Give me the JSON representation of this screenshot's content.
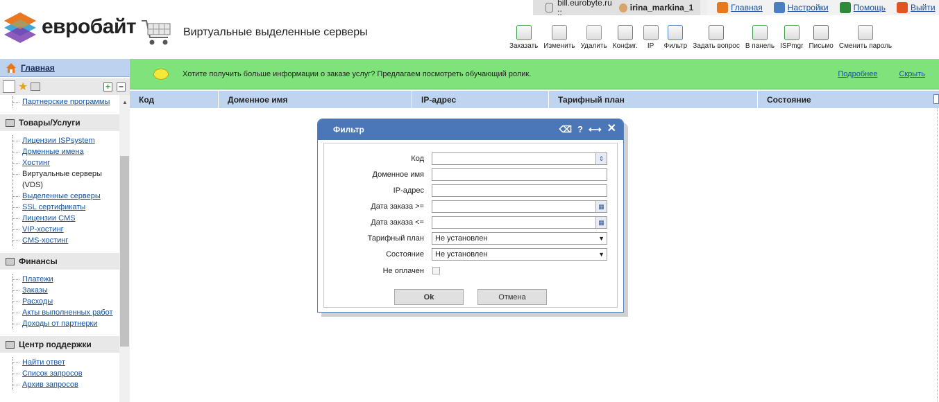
{
  "brand": {
    "name": "евробайт"
  },
  "page": {
    "title": "Виртуальные выделенные серверы"
  },
  "topbar": {
    "host": "bill.eurobyte.ru ::",
    "user": "irina_markina_1",
    "links": [
      {
        "label": "Главная",
        "icon": "home-icon",
        "color": "#e9781c"
      },
      {
        "label": "Настройки",
        "icon": "settings-icon",
        "color": "#4a7fc0"
      },
      {
        "label": "Помощь",
        "icon": "help-icon",
        "color": "#2f8a3a"
      },
      {
        "label": "Выйти",
        "icon": "power-icon",
        "color": "#e05520"
      }
    ]
  },
  "toolbar": [
    {
      "label": "Заказать",
      "icon": "order-icon",
      "color": "#3aa04a"
    },
    {
      "label": "Изменить",
      "icon": "edit-icon",
      "color": "#888"
    },
    {
      "label": "Удалить",
      "icon": "delete-icon",
      "color": "#999"
    },
    {
      "label": "Конфиг.",
      "icon": "config-icon",
      "color": "#777"
    },
    {
      "label": "IP",
      "icon": "ip-icon",
      "color": "#888"
    },
    {
      "label": "Фильтр",
      "icon": "filter-icon",
      "color": "#4a7fc0"
    },
    {
      "label": "Задать вопрос",
      "icon": "ask-question-icon",
      "color": "#777"
    },
    {
      "label": "В панель",
      "icon": "to-panel-icon",
      "color": "#3aa04a"
    },
    {
      "label": "ISPmgr",
      "icon": "ispmgr-icon",
      "color": "#3aa04a"
    },
    {
      "label": "Письмо",
      "icon": "letter-icon",
      "color": "#666"
    },
    {
      "label": "Сменить пароль",
      "icon": "change-password-icon",
      "color": "#888"
    }
  ],
  "sidebar": {
    "home": "Главная",
    "top_item": "Партнерские программы",
    "sections": [
      {
        "title": "Товары/Услуги",
        "icon": "cart-icon",
        "items": [
          {
            "label": "Лицензии ISPsystem",
            "link": true
          },
          {
            "label": "Доменные имена",
            "link": true
          },
          {
            "label": "Хостинг",
            "link": true
          },
          {
            "label": "Виртуальные серверы (VDS)",
            "link": false
          },
          {
            "label": "Выделенные серверы",
            "link": true
          },
          {
            "label": "SSL сертификаты",
            "link": true
          },
          {
            "label": "Лицензии CMS",
            "link": true
          },
          {
            "label": "VIP-хостинг",
            "link": true
          },
          {
            "label": "CMS-хостинг",
            "link": true
          }
        ]
      },
      {
        "title": "Финансы",
        "icon": "finance-icon",
        "items": [
          {
            "label": "Платежи",
            "link": true
          },
          {
            "label": "Заказы",
            "link": true
          },
          {
            "label": "Расходы",
            "link": true
          },
          {
            "label": "Акты выполненных работ",
            "link": true
          },
          {
            "label": "Доходы от партнерки",
            "link": true
          }
        ]
      },
      {
        "title": "Центр поддержки",
        "icon": "headset-icon",
        "items": [
          {
            "label": "Найти ответ",
            "link": true
          },
          {
            "label": "Список запросов",
            "link": true
          },
          {
            "label": "Архив запросов",
            "link": true
          }
        ]
      }
    ]
  },
  "banner": {
    "text": "Хотите получить больше информации о заказе услуг? Предлагаем посмотреть обучающий ролик.",
    "more": "Подробнее",
    "hide": "Скрыть"
  },
  "grid": {
    "columns": [
      "Код",
      "Доменное имя",
      "IP-адрес",
      "Тарифный план",
      "Состояние"
    ]
  },
  "dialog": {
    "title": "Фильтр",
    "fields": {
      "code": "Код",
      "domain": "Доменное имя",
      "ip": "IP-адрес",
      "date_from": "Дата заказа >=",
      "date_to": "Дата заказа <=",
      "plan": "Тарифный план",
      "state": "Состояние",
      "unpaid": "Не оплачен"
    },
    "plan_value": "Не установлен",
    "state_value": "Не установлен",
    "ok": "Ok",
    "cancel": "Отмена"
  }
}
